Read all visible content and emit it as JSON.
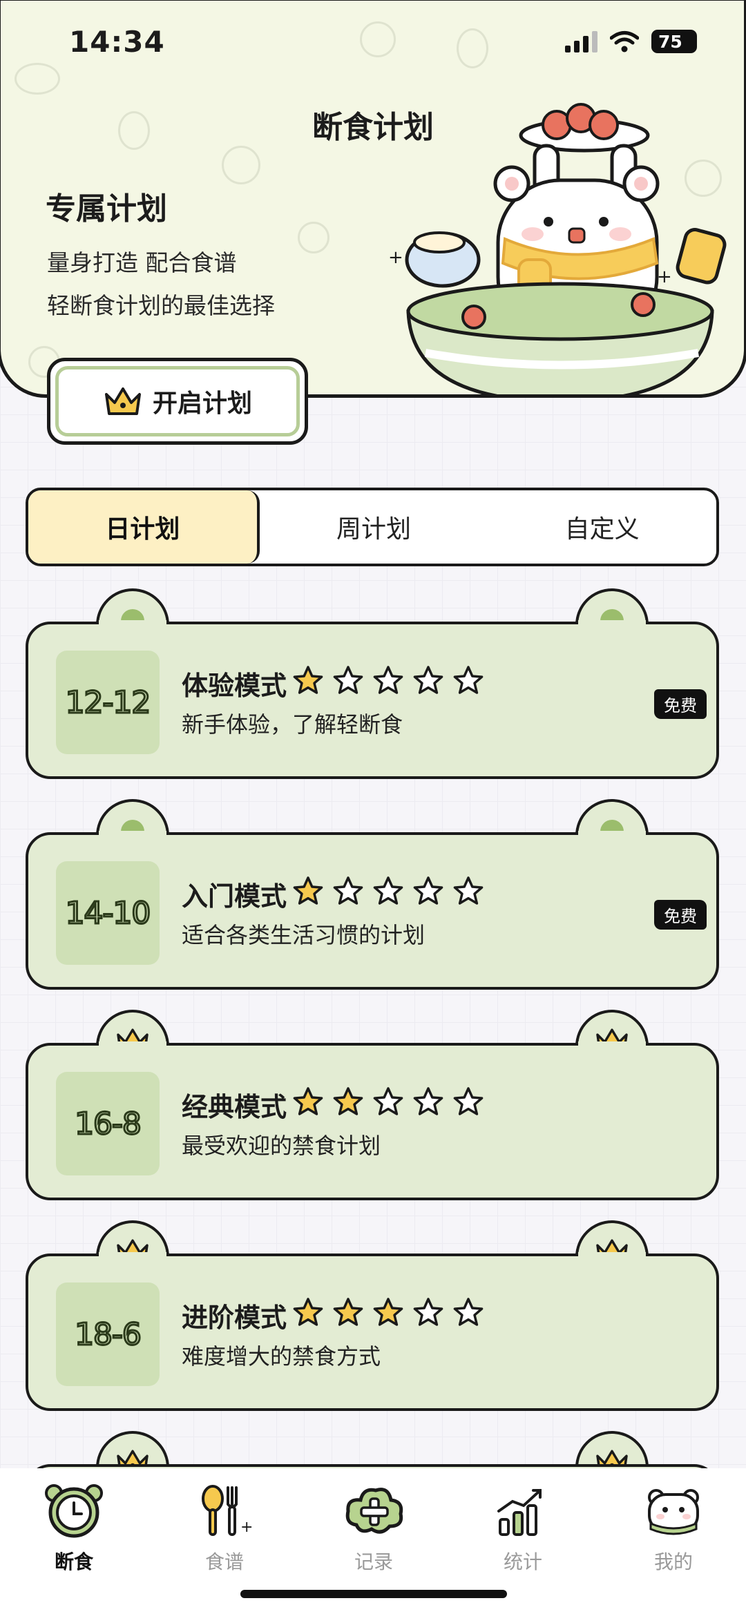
{
  "status": {
    "time": "14:34",
    "battery": "75"
  },
  "header": {
    "title": "断食计划",
    "hero_title": "专属计划",
    "hero_line1": "量身打造 配合食谱",
    "hero_line2": "轻断食计划的最佳选择",
    "start_button": "开启计划"
  },
  "tabs": [
    {
      "label": "日计划",
      "active": true
    },
    {
      "label": "周计划",
      "active": false
    },
    {
      "label": "自定义",
      "active": false
    }
  ],
  "plans": [
    {
      "ratio": "12-12",
      "name": "体验模式",
      "stars": 1,
      "desc": "新手体验，了解轻断食",
      "badge": "免费",
      "premium": false
    },
    {
      "ratio": "14-10",
      "name": "入门模式",
      "stars": 1,
      "desc": "适合各类生活习惯的计划",
      "badge": "免费",
      "premium": false
    },
    {
      "ratio": "16-8",
      "name": "经典模式",
      "stars": 2,
      "desc": "最受欢迎的禁食计划",
      "badge": "",
      "premium": true
    },
    {
      "ratio": "18-6",
      "name": "进阶模式",
      "stars": 3,
      "desc": "难度增大的禁食方式",
      "badge": "",
      "premium": true
    }
  ],
  "nav": [
    {
      "label": "断食",
      "icon": "alarm-clock-bear-icon",
      "active": true
    },
    {
      "label": "食谱",
      "icon": "spoon-fork-icon",
      "active": false
    },
    {
      "label": "记录",
      "icon": "plus-cloud-icon",
      "active": false
    },
    {
      "label": "统计",
      "icon": "bar-chart-icon",
      "active": false
    },
    {
      "label": "我的",
      "icon": "bear-face-icon",
      "active": false
    }
  ],
  "colors": {
    "accent_green": "#e3ecd3",
    "tile_green": "#cfe0b6",
    "active_tab": "#fdf0c4",
    "star_gold": "#f6c94e"
  }
}
